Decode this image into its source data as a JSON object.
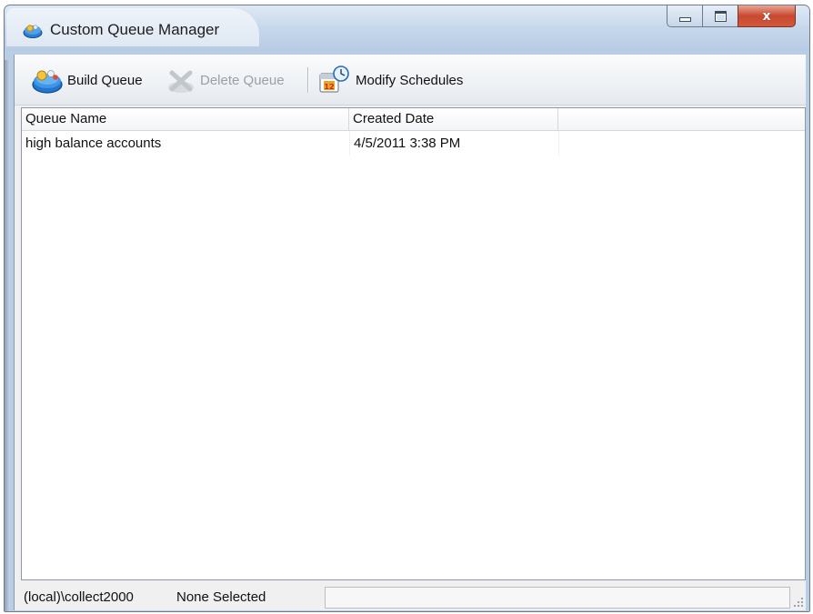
{
  "window": {
    "title": "Custom Queue Manager",
    "close_glyph": "x"
  },
  "toolbar": {
    "build_label": "Build Queue",
    "delete_label": "Delete Queue",
    "modify_label": "Modify Schedules"
  },
  "list": {
    "columns": [
      "Queue Name",
      "Created Date",
      ""
    ],
    "rows": [
      [
        "high balance accounts",
        "4/5/2011 3:38 PM",
        ""
      ]
    ]
  },
  "status": {
    "connection": "(local)\\collect2000",
    "selection": "None Selected",
    "info": ""
  },
  "colors": {
    "title_bg": "#c9d9ec",
    "close_button": "#c8492f",
    "client_bg": "#f0f0f0"
  },
  "icons": [
    "app-queue-icon",
    "build-queue-icon",
    "delete-queue-icon",
    "calendar-clock-icon",
    "minimize-icon",
    "maximize-icon",
    "close-icon",
    "resize-grip-icon"
  ]
}
